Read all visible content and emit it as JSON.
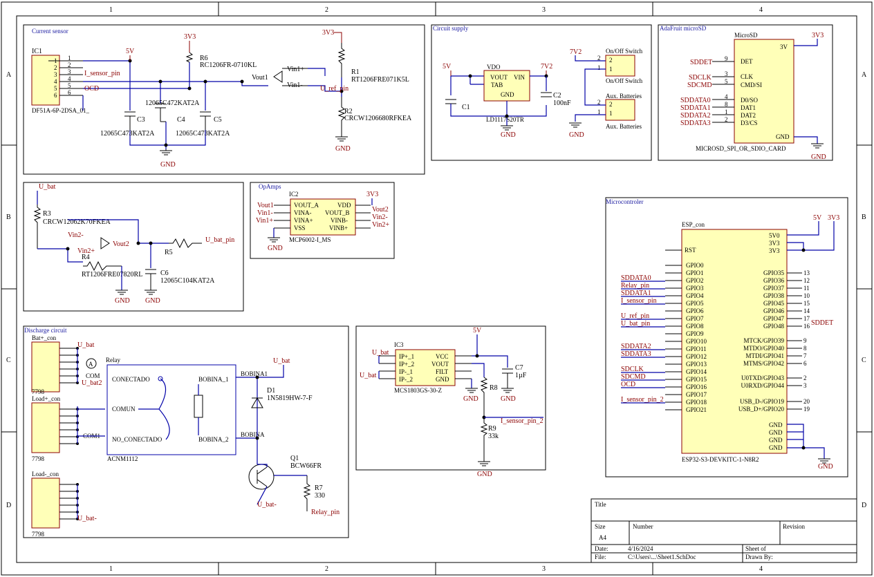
{
  "sheet": {
    "zones_cols": [
      "1",
      "2",
      "3",
      "4"
    ],
    "zones_rows": [
      "A",
      "B",
      "C",
      "D"
    ]
  },
  "blocks": {
    "current_sensor": "Current sensor",
    "circuit_supply": "Circuit supply",
    "adafruit": "AdaFruit microSD",
    "opamps": "OpAmps",
    "microcontroller": "Microcontroler",
    "discharge": "Discharge circuit"
  },
  "current_sensor": {
    "ic1": "IC1",
    "ic1_part": "DF51A-6P-2DSA_01_",
    "pins": [
      "1",
      "2",
      "3",
      "4",
      "5",
      "6"
    ],
    "net_5v": "5V",
    "net_3v3": "3V3",
    "net_isensor": "I_sensor_pin",
    "net_ocd": "OCD",
    "r6": "R6",
    "r6_part": "RC1206FR-0710KL",
    "c3": "C3",
    "c4": "C4",
    "c5": "C5",
    "c4_part": "12065C472KAT2A",
    "c3_part": "12065C473KAT2A",
    "c5_part": "12065C473KAT2A",
    "vout1": "Vout1",
    "vin1p": "Vin1+",
    "vin1m": "Vin1-",
    "r1": "R1",
    "r1_part": "RT1206FRE071K5L",
    "r2": "R2",
    "r2_part": "CRCW1206680RFKEA",
    "uref": "U_ref_pin",
    "gnd": "GND"
  },
  "circuit_supply": {
    "vdo": "VDO",
    "vout": "VOUT",
    "vin": "VIN",
    "tab": "TAB",
    "gnd": "GND",
    "part": "LD1117S20TR",
    "c1": "C1",
    "c2": "C2",
    "c2_val": "100nF",
    "net_5v": "5V",
    "net_7v2": "7V2",
    "net_7v2b": "7V2",
    "switch_top": "On/Off Switch",
    "switch_bot": "On/Off Switch",
    "aux_top": "Aux. Batteries",
    "aux_bot": "Aux. Batteries"
  },
  "microsd": {
    "title": "MicroSD",
    "part": "MICROSD_SPI_OR_SDIO_CARD",
    "v3": "3V",
    "net3v3": "3V3",
    "det": "DET",
    "clk": "CLK",
    "cmd": "CMD/SI",
    "d0": "D0/SO",
    "d1": "DAT1",
    "d2": "DAT2",
    "d3": "D3/CS",
    "gnd": "GND",
    "nets": [
      "SDDET",
      "SDCLK",
      "SDCMD",
      "SDDATA0",
      "SDDATA1",
      "SDDATA2",
      "SDDATA3"
    ],
    "pin_nums": [
      "9",
      "3",
      "5",
      "4",
      "8",
      "1",
      "2"
    ]
  },
  "opamp_stage": {
    "u_bat": "U_bat",
    "r3": "R3",
    "r3_part": "CRCW12062K70FKEA",
    "vin2m": "Vin2-",
    "vin2p": "Vin2+",
    "vout2": "Vout2",
    "r4": "R4",
    "r4_part": "RT1206FRE07820RL",
    "r5": "R5",
    "c6": "C6",
    "c6_part": "12065C104KAT2A",
    "u_bat_pin": "U_bat_pin",
    "gnd": "GND"
  },
  "opamps": {
    "ic2": "IC2",
    "part": "MCP6002-I_MS",
    "net3v3": "3V3",
    "left": [
      "VOUT_A",
      "VINA-",
      "VINA+",
      "VSS"
    ],
    "right": [
      "VDD",
      "VOUT_B",
      "VINB-",
      "VINB+"
    ],
    "left_nets": [
      "Vout1",
      "Vin1-",
      "Vin1+"
    ],
    "right_nets": [
      "Vout2",
      "Vin2-",
      "Vin2+"
    ],
    "gnd": "GND"
  },
  "esp": {
    "title": "ESP_con",
    "part": "ESP32-S3-DEVKITC-1-N8R2",
    "net5v": "5V",
    "net3v3": "3V3",
    "top_right": [
      "5V0",
      "3V3",
      "3V3"
    ],
    "rst": "RST",
    "left": [
      "GPIO0",
      "GPIO1",
      "GPIO2",
      "GPIO3",
      "GPIO4",
      "GPIO5",
      "GPIO6",
      "GPIO7",
      "GPIO8",
      "GPIO9",
      "GPIO10",
      "GPIO11",
      "GPIO12",
      "GPIO13",
      "GPIO14",
      "GPIO15",
      "GPIO16",
      "GPIO17",
      "GPIO18",
      "GPIO21"
    ],
    "left_nets": [
      "",
      "",
      "SDDATA0",
      "Relay_pin",
      "SDDATA1",
      "I_sensor_pin",
      "",
      "U_ref_pin",
      "U_bat_pin",
      "",
      "",
      "SDDATA2",
      "SDDATA3",
      "",
      "SDCLK",
      "SDCMD",
      "OCD",
      "",
      "I_sensor_pin_2",
      ""
    ],
    "right": [
      "GPIO35",
      "GPIO36",
      "GPIO37",
      "GPIO38",
      "GPIO45",
      "GPIO46",
      "GPIO47",
      "GPIO48",
      "MTCK/GPIO39",
      "MTDO/GPIO40",
      "MTDI/GPIO41",
      "MTMS/GPIO42",
      "U0TXD/GPIO43",
      "U0RXD/GPIO44",
      "USB_D-/GPIO19",
      "USB_D+/GPIO20"
    ],
    "right_pins": [
      "13",
      "12",
      "11",
      "10",
      "15",
      "14",
      "17",
      "16",
      "9",
      "8",
      "7",
      "6",
      "2",
      "3",
      "20",
      "19"
    ],
    "sddet": "SDDET",
    "gnds": [
      "GND",
      "GND",
      "GND",
      "GND"
    ],
    "gnd": "GND"
  },
  "ic3": {
    "title": "IC3",
    "part": "MCS1803GS-30-Z",
    "left": [
      "IP+_1",
      "IP+_2",
      "IP-_1",
      "IP-_2"
    ],
    "right": [
      "VCC",
      "VOUT",
      "FILT",
      "GND"
    ],
    "u_bat": "U_bat",
    "u_bat2": "U_bat",
    "net5v": "5V",
    "c7": "C7",
    "c7_val": "1µF",
    "r8": "R8",
    "r9": "R9",
    "r9_val": "33k",
    "i_sensor_2": "I_sensor_pin_2",
    "gnd": "GND"
  },
  "discharge": {
    "bat_con": "Bat+_con",
    "load_plus": "Load+_con",
    "load_minus": "Load-_con",
    "con_part": "7798",
    "u_bat": "U_bat",
    "u_bat2": "U_bat2",
    "u_batm": "U_bat-",
    "relay": "Relay",
    "relay_part": "ACNM1112",
    "conectado": "CONECTADO",
    "comun": "COMUN",
    "no_conectado": "NO_CONECTADO",
    "bobina1": "BOBINA_1",
    "bobina2": "BOBINA_2",
    "bobina1_net": "BOBINA1",
    "bobina_net": "BOBINA",
    "com": "COM",
    "com1": "COM1",
    "d1": "D1",
    "d1_part": "1N5819HW-7-F",
    "q1": "Q1",
    "q1_part": "BCW66FR",
    "r7": "R7",
    "r7_val": "330",
    "relay_pin": "Relay_pin",
    "ammeter": "A"
  },
  "title_block": {
    "title": "Title",
    "size": "Size",
    "size_val": "A4",
    "number": "Number",
    "revision": "Revision",
    "date": "Date:",
    "date_val": "4/16/2024",
    "sheet": "Sheet   of",
    "file": "File:",
    "file_val": "C:\\Users\\...\\Sheet1.SchDoc",
    "drawn": "Drawn By:"
  }
}
